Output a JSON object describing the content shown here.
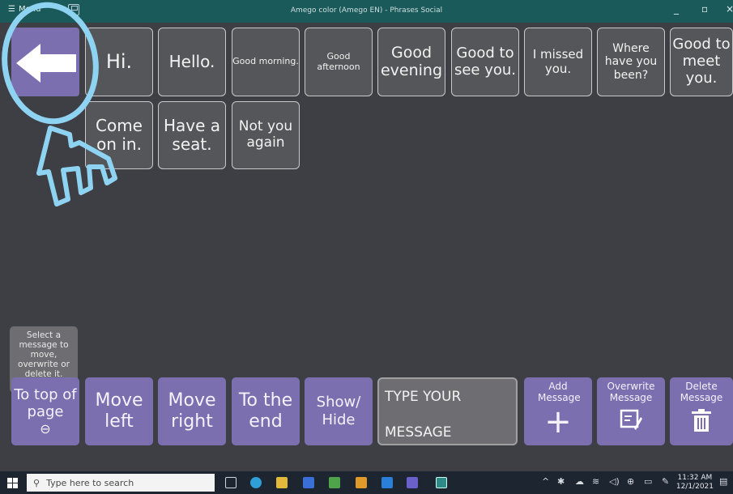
{
  "titlebar": {
    "menu_label": "Menu",
    "title": "Amego color (Amego EN) - Phrases Social",
    "minimize": "_",
    "maximize": "▫",
    "close": "×"
  },
  "phrases": [
    "Hi.",
    "Hello.",
    "Good morning.",
    "Good afternoon",
    "Good evening",
    "Good to see you.",
    "I missed you.",
    "Where have you been?",
    "Good to meet you.",
    "Come on in.",
    "Have a seat.",
    "Not you again"
  ],
  "info_text": "Select a message to move, overwrite or delete it.",
  "bottom": {
    "to_top": "To top of page",
    "move_left": "Move left",
    "move_right": "Move right",
    "to_end": "To the end",
    "show_hide": "Show/ Hide",
    "message_line1": "TYPE YOUR",
    "message_line2": "MESSAGE",
    "add_label": "Add Message",
    "overwrite_label": "Overwrite Message",
    "delete_label": "Delete Message"
  },
  "taskbar": {
    "search_placeholder": "Type here to search",
    "time": "11:32 AM",
    "date": "12/1/2021"
  },
  "colors": {
    "titlebar": "#1b5a5a",
    "background": "#3e3f45",
    "accent_purple": "#7b6fb0",
    "tile": "#555659",
    "annotation_blue": "#8fd3f2"
  }
}
